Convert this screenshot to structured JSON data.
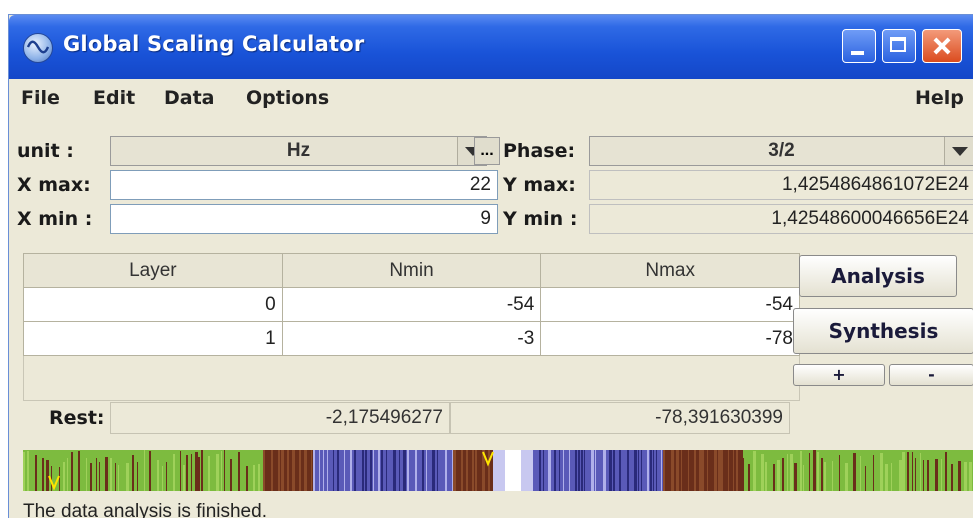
{
  "window": {
    "title": "Global Scaling Calculator"
  },
  "menu": {
    "file": "File",
    "edit": "Edit",
    "data": "Data",
    "options": "Options",
    "help": "Help"
  },
  "fields": {
    "unit_label": "unit :",
    "unit_value": "Hz",
    "unit_more": "...",
    "phase_label": "Phase:",
    "phase_value": "3/2",
    "xmax_label": "X max:",
    "xmax_value": "22",
    "xmin_label": "X min :",
    "xmin_value": "9",
    "ymax_label": "Y max:",
    "ymax_value": "1,4254864861072E24",
    "ymin_label": "Y min :",
    "ymin_value": "1,42548600046656E24"
  },
  "table": {
    "headers": [
      "Layer",
      "Nmin",
      "Nmax"
    ],
    "rows": [
      [
        "0",
        "-54",
        "-54"
      ],
      [
        "1",
        "-3",
        "-78"
      ]
    ]
  },
  "buttons": {
    "analysis": "Analysis",
    "synthesis": "Synthesis",
    "plus": "+",
    "minus": "-"
  },
  "rest": {
    "label": "Rest:",
    "value1": "-2,175496277",
    "value2": "-78,391630399"
  },
  "spectrum": {
    "colors": {
      "green": "#7dbb3f",
      "brown": "#6a2e1a",
      "blue": "#5a5ab8",
      "white": "#ffffff",
      "marker": "#ffe600"
    }
  },
  "status": "The data analysis is finished."
}
